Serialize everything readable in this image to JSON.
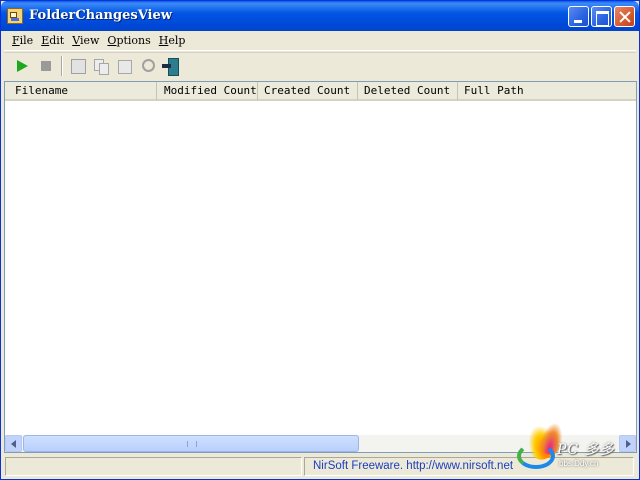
{
  "window": {
    "title": "FolderChangesView"
  },
  "menu": [
    {
      "label": "File",
      "key": "F",
      "rest": "ile"
    },
    {
      "label": "Edit",
      "key": "E",
      "rest": "dit"
    },
    {
      "label": "View",
      "key": "V",
      "rest": "iew"
    },
    {
      "label": "Options",
      "key": "O",
      "rest": "ptions"
    },
    {
      "label": "Help",
      "key": "H",
      "rest": "elp"
    }
  ],
  "toolbar": {
    "icons": [
      "play-icon",
      "stop-icon",
      "save-icon",
      "copy-icon",
      "properties-icon",
      "find-icon",
      "exit-icon"
    ]
  },
  "table": {
    "columns": [
      "Filename",
      "Modified Count",
      "Created Count",
      "Deleted Count",
      "Full Path"
    ],
    "rows": []
  },
  "status": {
    "pane1": "",
    "link": "NirSoft Freeware.  http://www.nirsoft.net"
  },
  "watermark": {
    "text": "PC  多多",
    "sub": "bbs.Ddy.cn"
  }
}
